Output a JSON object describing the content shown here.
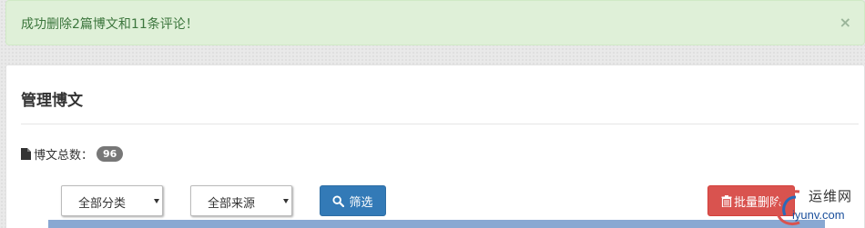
{
  "alert": {
    "message": "成功删除2篇博文和11条评论！",
    "close_label": "×",
    "color": "#3c763d"
  },
  "panel": {
    "title": "管理博文",
    "count_label": "博文总数：",
    "count_value": "96"
  },
  "filters": {
    "category_selected": "全部分类",
    "source_selected": "全部来源",
    "filter_button": "筛选"
  },
  "actions": {
    "batch_delete": "批量删除"
  },
  "watermark": {
    "cn": "运维网",
    "en": "iyunv.com"
  },
  "colors": {
    "primary": "#337ab7",
    "danger": "#d9534f",
    "success_bg": "#dff0d8",
    "table_header": "#89a8d2"
  }
}
